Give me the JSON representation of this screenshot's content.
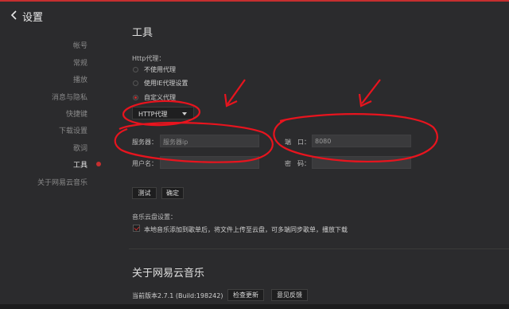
{
  "header": {
    "title": "设置"
  },
  "sidebar": {
    "items": [
      {
        "label": "帐号"
      },
      {
        "label": "常规"
      },
      {
        "label": "播放"
      },
      {
        "label": "消息与隐私"
      },
      {
        "label": "快捷键"
      },
      {
        "label": "下载设置"
      },
      {
        "label": "歌词"
      },
      {
        "label": "工具"
      },
      {
        "label": "关于网易云音乐"
      }
    ],
    "active_index": 7
  },
  "tools": {
    "section_title": "工具",
    "http_proxy_label": "Http代理：",
    "radio_options": [
      {
        "label": "不使用代理",
        "checked": false
      },
      {
        "label": "使用IE代理设置",
        "checked": false
      },
      {
        "label": "自定义代理",
        "checked": true
      }
    ],
    "proxy_type_selected": "HTTP代理",
    "server_label": "服务器：",
    "server_placeholder": "服务器ip",
    "port_label": "端　口：",
    "port_value": "8080",
    "username_label": "用户名：",
    "password_label": "密　码：",
    "test_button": "测试",
    "confirm_button": "确定",
    "cloud_label": "音乐云盘设置：",
    "cloud_checkbox_label": "本地音乐添加到歌单后，将文件上传至云盘，可多端同步歌单，播放下载",
    "cloud_checkbox_checked": true
  },
  "about": {
    "section_title": "关于网易云音乐",
    "version_text": "当前版本2.7.1 (Build:198242)",
    "check_update_button": "检查更新",
    "feedback_button": "意见反馈"
  },
  "colors": {
    "accent": "#c62f2f",
    "annotation": "#e8141e",
    "background": "#2b2b2d"
  },
  "icons": {
    "back": "chevron-left-icon",
    "select_caret": "caret-down-icon",
    "check": "checkmark-icon"
  }
}
